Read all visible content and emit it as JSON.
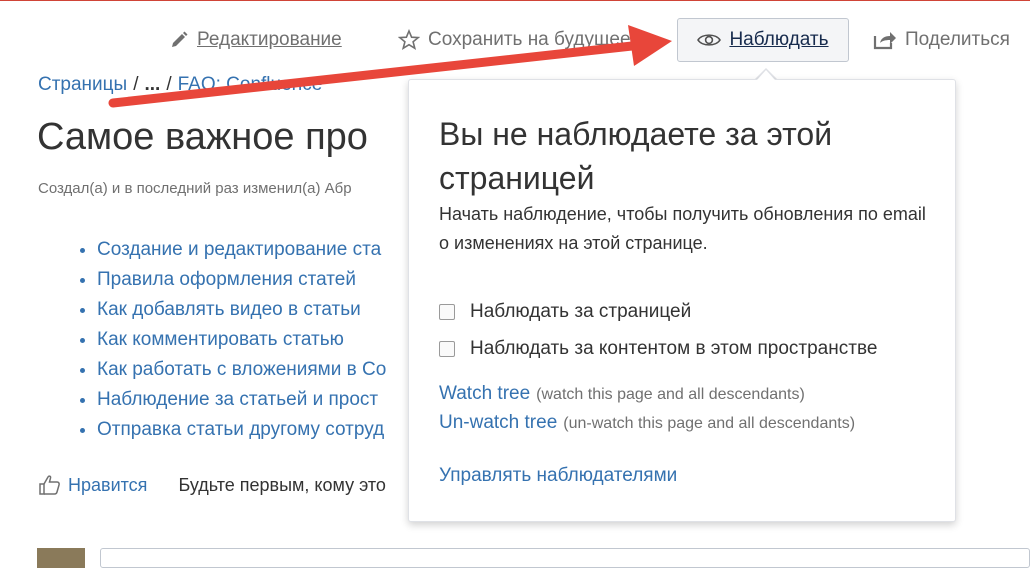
{
  "toolbar": {
    "edit_label": "Редактирование",
    "save_later_label": "Сохранить на будущее",
    "watch_label": "Наблюдать",
    "share_label": "Поделиться"
  },
  "breadcrumb": {
    "pages": "Страницы",
    "ellipsis": "...",
    "parent": "FAQ: Confluence"
  },
  "page": {
    "title": "Самое важное про",
    "byline": "Создал(а) и в последний раз изменил(а) Абр"
  },
  "toc": [
    "Создание и редактирование ста",
    "Правила оформления статей",
    "Как добавлять видео в статьи",
    "Как комментировать статью",
    "Как работать с вложениями в Co",
    "Наблюдение за статьей и прост",
    "Отправка статьи другому сотруд"
  ],
  "likes": {
    "like_label": "Нравится",
    "first_text": "Будьте первым, кому это"
  },
  "watch_popup": {
    "title": "Вы не наблюдаете за этой страницей",
    "description": "Начать наблюдение, чтобы получить обновления по email о изменениях на этой странице.",
    "watch_page_label": "Наблюдать за страницей",
    "watch_space_label": "Наблюдать за контентом в этом пространстве",
    "watch_tree_link": "Watch tree",
    "watch_tree_hint": "(watch this page and all descendants)",
    "unwatch_tree_link": "Un-watch tree",
    "unwatch_tree_hint": "(un-watch this page and all descendants)",
    "manage_watchers": "Управлять наблюдателями"
  },
  "colors": {
    "link": "#3572b0",
    "annotation_arrow": "#e8463a"
  },
  "icons": [
    "pencil-icon",
    "star-icon",
    "eye-icon",
    "share-icon",
    "thumbs-up-icon"
  ]
}
